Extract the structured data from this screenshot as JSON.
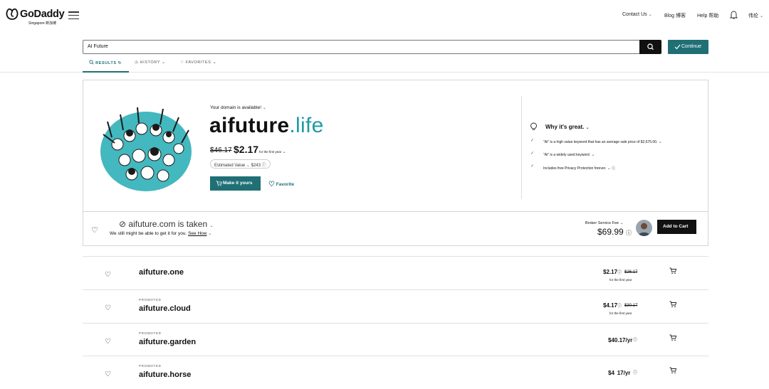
{
  "header": {
    "logo_text": "GoDaddy",
    "logo_sub": "Singapore 新加坡",
    "nav": [
      {
        "label": "Contact Us"
      },
      {
        "label": "Blog 博客"
      },
      {
        "label": "Help 帮助"
      },
      {
        "label": "伟伦"
      }
    ]
  },
  "search": {
    "value": "AI Future",
    "continue_label": "Continue"
  },
  "tabs": [
    {
      "label": "RESULTS"
    },
    {
      "label": "HISTORY"
    },
    {
      "label": "FAVORITES"
    }
  ],
  "featured": {
    "available_text": "Your domain is available!",
    "domain_name": "aifuture",
    "domain_tld": ".life",
    "old_price": "$46.17",
    "new_price": "$2.17",
    "price_note": "for the first year",
    "estimated_label": "Estimated Value",
    "estimated_value": "$243",
    "make_label": "Make it yours",
    "favorite_label": "Favorite",
    "why_title": "Why it's great.",
    "why_items": [
      "\"Ai\" is a high value keyword that has an average sale price of $2,675.00.",
      "\"Ai\" is a widely used keyword.",
      "Includes free Privacy Protection forever."
    ]
  },
  "taken": {
    "title": "aifuture.com is taken",
    "subtitle": "We still might be able to get it for you.",
    "see_how": "See How",
    "broker_label": "Broker Service Fee",
    "broker_price": "$69.99",
    "add_label": "Add to Cart"
  },
  "results": [
    {
      "promo": "",
      "name": "aifuture.one",
      "price": "$2.17",
      "old": "$26.17",
      "note": "for the first year"
    },
    {
      "promo": "PROMOTED",
      "name": "aifuture.cloud",
      "price": "$4.17",
      "old": "$30.17",
      "note": "for the first year"
    },
    {
      "promo": "PROMOTED",
      "name": "aifuture.garden",
      "price": "$40.17/yr",
      "old": "",
      "note": ""
    },
    {
      "promo": "PROMOTED",
      "name": "aifuture.horse",
      "price": "$4  17/yr",
      "old": "",
      "note": ""
    }
  ],
  "colors": {
    "teal": "#1f6f75",
    "teal_light": "#1f9aa6",
    "illus_bg": "#43b8bf"
  }
}
